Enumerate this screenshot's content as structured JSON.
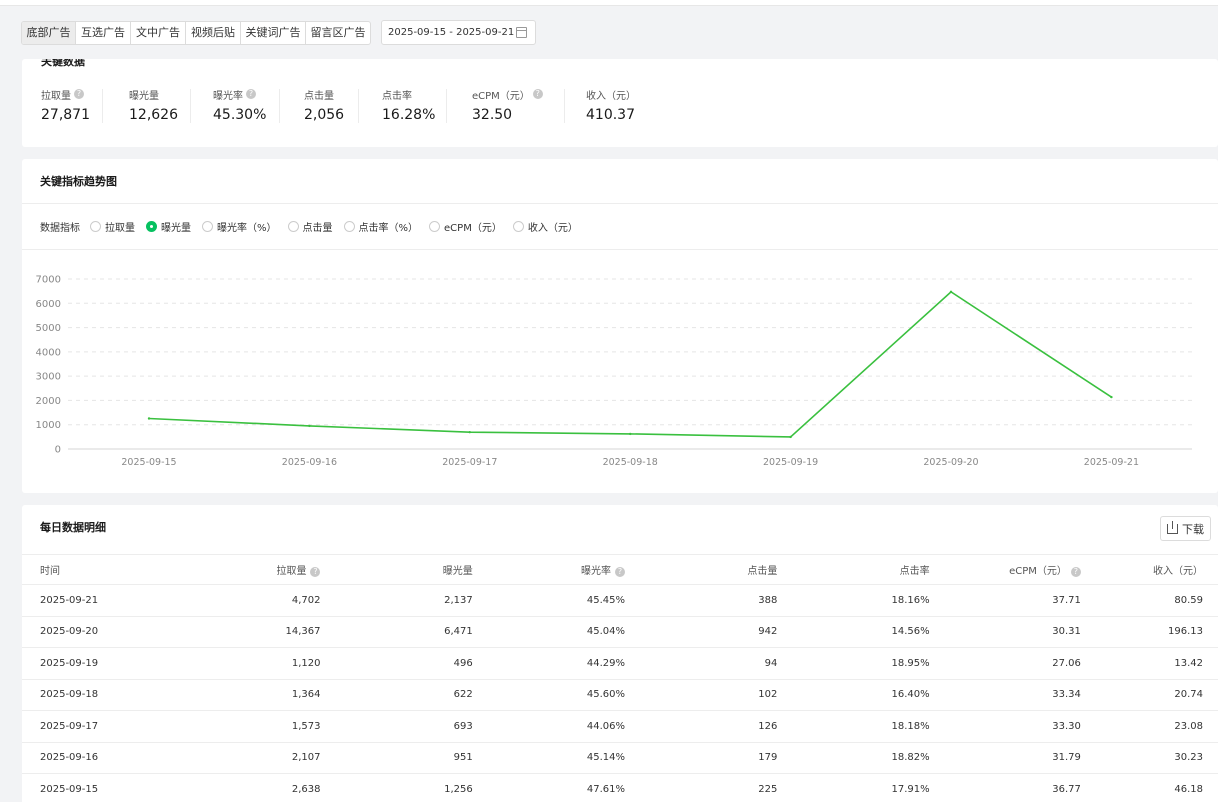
{
  "tabs": [
    "底部广告",
    "互选广告",
    "文中广告",
    "视频后贴",
    "关键词广告",
    "留言区广告"
  ],
  "date_range": "2025-09-15 - 2025-09-21",
  "key_data": {
    "title": "关键数据",
    "metrics": [
      {
        "label": "拉取量",
        "value": "27,871",
        "help": true
      },
      {
        "label": "曝光量",
        "value": "12,626",
        "help": false
      },
      {
        "label": "曝光率",
        "value": "45.30%",
        "help": true
      },
      {
        "label": "点击量",
        "value": "2,056",
        "help": false
      },
      {
        "label": "点击率",
        "value": "16.28%",
        "help": false
      },
      {
        "label": "eCPM（元）",
        "value": "32.50",
        "help": true
      },
      {
        "label": "收入（元）",
        "value": "410.37",
        "help": false
      }
    ]
  },
  "trend": {
    "title": "关键指标趋势图",
    "selector_label": "数据指标",
    "options": [
      "拉取量",
      "曝光量",
      "曝光率（%）",
      "点击量",
      "点击率（%）",
      "eCPM（元）",
      "收入（元）"
    ],
    "selected": 1
  },
  "chart_data": {
    "type": "line",
    "title": "",
    "xlabel": "",
    "ylabel": "",
    "categories": [
      "2025-09-15",
      "2025-09-16",
      "2025-09-17",
      "2025-09-18",
      "2025-09-19",
      "2025-09-20",
      "2025-09-21"
    ],
    "series": [
      {
        "values": [
          1256,
          951,
          693,
          622,
          496,
          6471,
          2137
        ]
      }
    ],
    "y_ticks": [
      0,
      1000,
      2000,
      3000,
      4000,
      5000,
      6000,
      7000
    ],
    "ylim": [
      0,
      7000
    ],
    "grid": true,
    "color": "#3ac03f"
  },
  "daily": {
    "title": "每日数据明细",
    "download_label": "下载",
    "headers": [
      {
        "label": "时间",
        "help": false
      },
      {
        "label": "拉取量",
        "help": true
      },
      {
        "label": "曝光量",
        "help": false
      },
      {
        "label": "曝光率",
        "help": true
      },
      {
        "label": "点击量",
        "help": false
      },
      {
        "label": "点击率",
        "help": false
      },
      {
        "label": "eCPM（元）",
        "help": true
      },
      {
        "label": "收入（元）",
        "help": false
      }
    ],
    "rows": [
      [
        "2025-09-21",
        "4,702",
        "2,137",
        "45.45%",
        "388",
        "18.16%",
        "37.71",
        "80.59"
      ],
      [
        "2025-09-20",
        "14,367",
        "6,471",
        "45.04%",
        "942",
        "14.56%",
        "30.31",
        "196.13"
      ],
      [
        "2025-09-19",
        "1,120",
        "496",
        "44.29%",
        "94",
        "18.95%",
        "27.06",
        "13.42"
      ],
      [
        "2025-09-18",
        "1,364",
        "622",
        "45.60%",
        "102",
        "16.40%",
        "33.34",
        "20.74"
      ],
      [
        "2025-09-17",
        "1,573",
        "693",
        "44.06%",
        "126",
        "18.18%",
        "33.30",
        "23.08"
      ],
      [
        "2025-09-16",
        "2,107",
        "951",
        "45.14%",
        "179",
        "18.82%",
        "31.79",
        "30.23"
      ],
      [
        "2025-09-15",
        "2,638",
        "1,256",
        "47.61%",
        "225",
        "17.91%",
        "36.77",
        "46.18"
      ]
    ]
  }
}
